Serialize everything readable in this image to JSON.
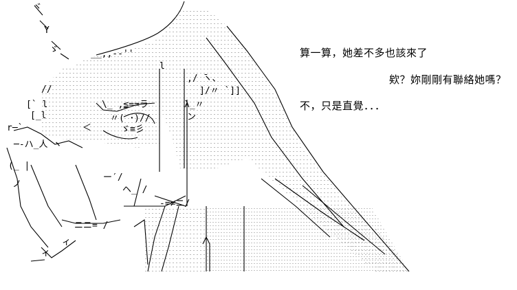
{
  "dialogue": [
    "算一算，她差不多也該來了",
    "欸？妳剛剛有聯絡她嗎？",
    "不，只是直覺．．．"
  ],
  "colors": {
    "background": "#ffffff",
    "ink": "#000000",
    "shading": "#b8b8b8"
  }
}
